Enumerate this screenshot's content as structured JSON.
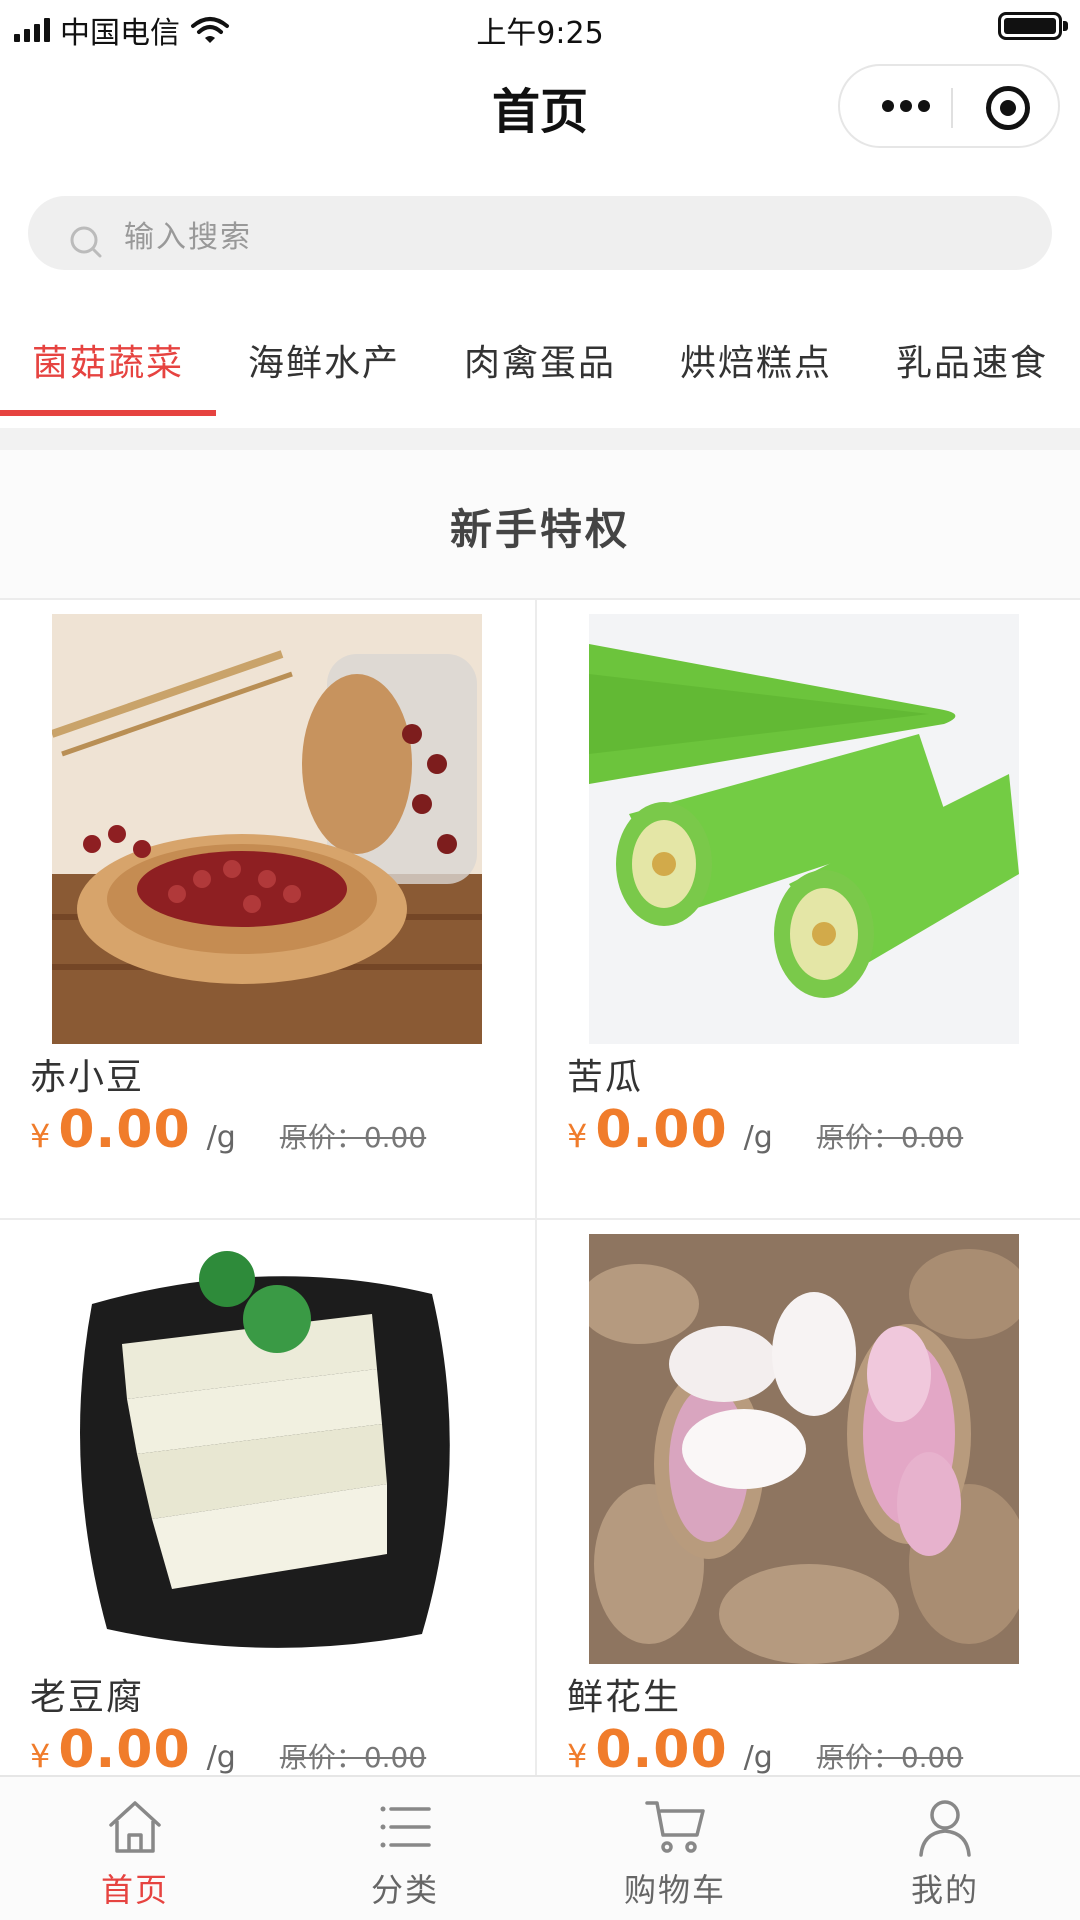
{
  "status_bar": {
    "carrier": "中国电信",
    "time": "上午9:25"
  },
  "nav": {
    "title": "首页"
  },
  "search": {
    "placeholder": "输入搜索"
  },
  "categories": [
    {
      "label": "菌菇蔬菜",
      "active": true
    },
    {
      "label": "海鲜水产",
      "active": false
    },
    {
      "label": "肉禽蛋品",
      "active": false
    },
    {
      "label": "烘焙糕点",
      "active": false
    },
    {
      "label": "乳品速食",
      "active": false
    }
  ],
  "section": {
    "title": "新手特权"
  },
  "products": [
    {
      "name": "赤小豆",
      "currency": "¥",
      "price": "0.00",
      "unit": "/g",
      "original": "原价：0.00"
    },
    {
      "name": "苦瓜",
      "currency": "¥",
      "price": "0.00",
      "unit": "/g",
      "original": "原价：0.00"
    },
    {
      "name": "老豆腐",
      "currency": "¥",
      "price": "0.00",
      "unit": "/g",
      "original": "原价：0.00"
    },
    {
      "name": "鲜花生",
      "currency": "¥",
      "price": "0.00",
      "unit": "/g",
      "original": "原价：0.00"
    }
  ],
  "tabbar": [
    {
      "label": "首页",
      "icon": "home-icon",
      "active": true
    },
    {
      "label": "分类",
      "icon": "list-icon",
      "active": false
    },
    {
      "label": "购物车",
      "icon": "cart-icon",
      "active": false
    },
    {
      "label": "我的",
      "icon": "user-icon",
      "active": false
    }
  ],
  "colors": {
    "accent": "#e64340",
    "price": "#f07c2b"
  }
}
